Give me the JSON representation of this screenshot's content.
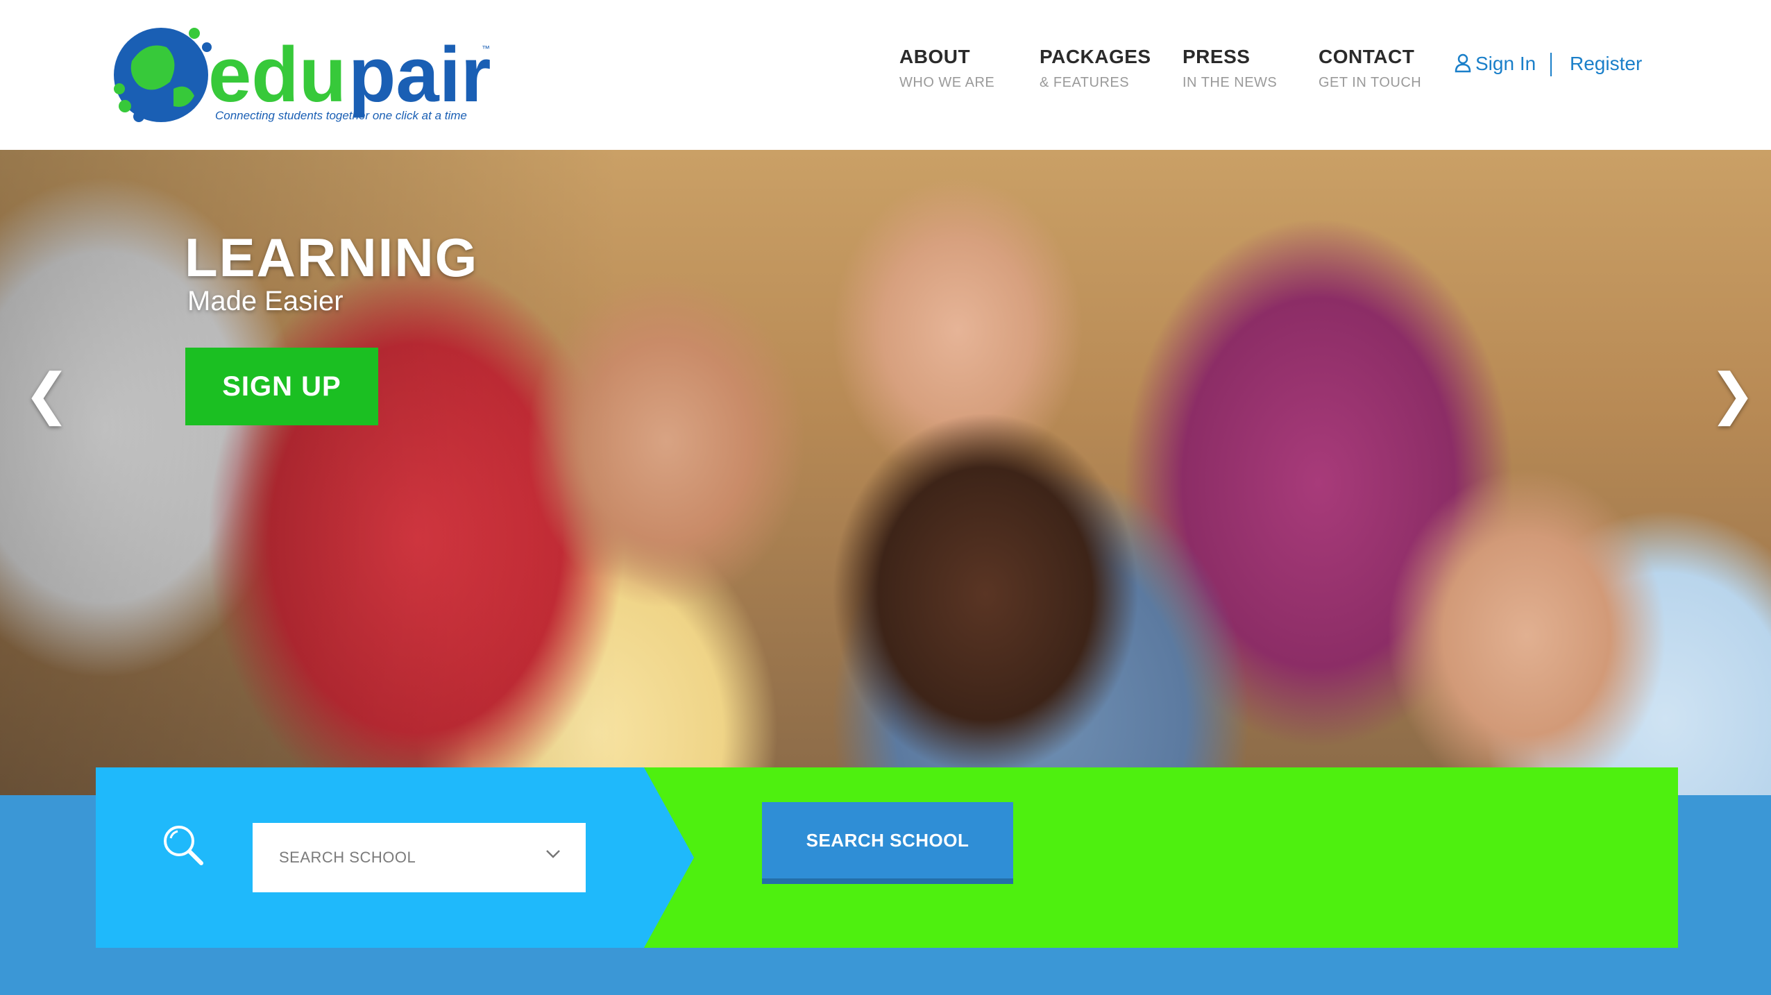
{
  "brand": {
    "logo_text": "edupair",
    "tagline": "Connecting students together one click at a time",
    "tm": "™"
  },
  "nav": [
    {
      "title": "ABOUT",
      "subtitle": "WHO WE ARE"
    },
    {
      "title": "PACKAGES",
      "subtitle": "& FEATURES"
    },
    {
      "title": "PRESS",
      "subtitle": "IN THE NEWS"
    },
    {
      "title": "CONTACT",
      "subtitle": "GET IN TOUCH"
    }
  ],
  "auth": {
    "sign_in": "Sign In",
    "register": "Register",
    "user_icon": "user-icon"
  },
  "hero": {
    "title": "LEARNING",
    "subtitle": "Made Easier",
    "cta": "SIGN UP",
    "prev_icon": "chevron-left-icon",
    "next_icon": "chevron-right-icon",
    "prev_glyph": "❮",
    "next_glyph": "❯"
  },
  "search": {
    "icon": "search-icon",
    "select_placeholder": "SEARCH SCHOOL",
    "button_label": "SEARCH SCHOOL"
  },
  "colors": {
    "primary_blue": "#1a7fc9",
    "signup_green": "#1bbf22",
    "panel_cyan": "#1fb9fb",
    "panel_green": "#4ef00f",
    "button_blue": "#2f8ed6",
    "footer_blue": "#3b97d6"
  }
}
